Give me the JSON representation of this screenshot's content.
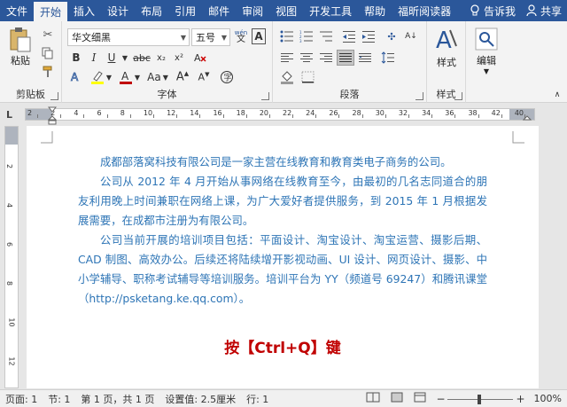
{
  "tabs": [
    {
      "label": "文件",
      "active": false
    },
    {
      "label": "开始",
      "active": true
    },
    {
      "label": "插入",
      "active": false
    },
    {
      "label": "设计",
      "active": false
    },
    {
      "label": "布局",
      "active": false
    },
    {
      "label": "引用",
      "active": false
    },
    {
      "label": "邮件",
      "active": false
    },
    {
      "label": "审阅",
      "active": false
    },
    {
      "label": "视图",
      "active": false
    },
    {
      "label": "开发工具",
      "active": false
    },
    {
      "label": "帮助",
      "active": false
    },
    {
      "label": "福昕阅读器",
      "active": false
    }
  ],
  "tellme": "告诉我",
  "share": "共享",
  "ribbon": {
    "clipboard": {
      "label": "剪贴板",
      "paste": "粘贴"
    },
    "font": {
      "label": "字体",
      "name": "华文细黑",
      "size": "五号",
      "wen": "wén",
      "A": "A",
      "aa": "Aa"
    },
    "paragraph": {
      "label": "段落"
    },
    "styles": {
      "label": "样式",
      "styles_btn": "样式"
    },
    "editing": {
      "edit_btn": "编辑"
    }
  },
  "ruler": {
    "numbers": [
      "2",
      "2",
      "4",
      "6",
      "8",
      "10",
      "12",
      "14",
      "16",
      "18",
      "20",
      "22",
      "24",
      "26",
      "28",
      "30",
      "32",
      "34",
      "36",
      "38",
      "42",
      "40"
    ]
  },
  "vruler": {
    "numbers": [
      "2",
      "4",
      "6",
      "8",
      "10",
      "12"
    ]
  },
  "document": {
    "paragraphs": [
      "成都部落窝科技有限公司是一家主营在线教育和教育类电子商务的公司。",
      "公司从 2012 年 4 月开始从事网络在线教育至今，由最初的几名志同道合的朋友利用晚上时间兼职在网络上课，为广大爱好者提供服务，到 2015 年 1 月根据发展需要，在成都市注册为有限公司。",
      "公司当前开展的培训项目包括：平面设计、淘宝设计、淘宝运营、摄影后期、CAD 制图、高效办公。后续还将陆续增开影视动画、UI 设计、网页设计、摄影、中小学辅导、职称考试辅导等培训服务。培训平台为 YY（频道号 69247）和腾讯课堂（http://psketang.ke.qq.com）。"
    ],
    "caption": "按【Ctrl+Q】键"
  },
  "status": {
    "page": "页面: 1",
    "section": "节: 1",
    "page_of": "第 1 页，共 1 页",
    "setting": "设置值: 2.5厘米",
    "line": "行: 1",
    "zoom": "100%"
  },
  "colors": {
    "accent": "#2b579a",
    "doc_text": "#2e75b6",
    "caption": "#c00000"
  }
}
